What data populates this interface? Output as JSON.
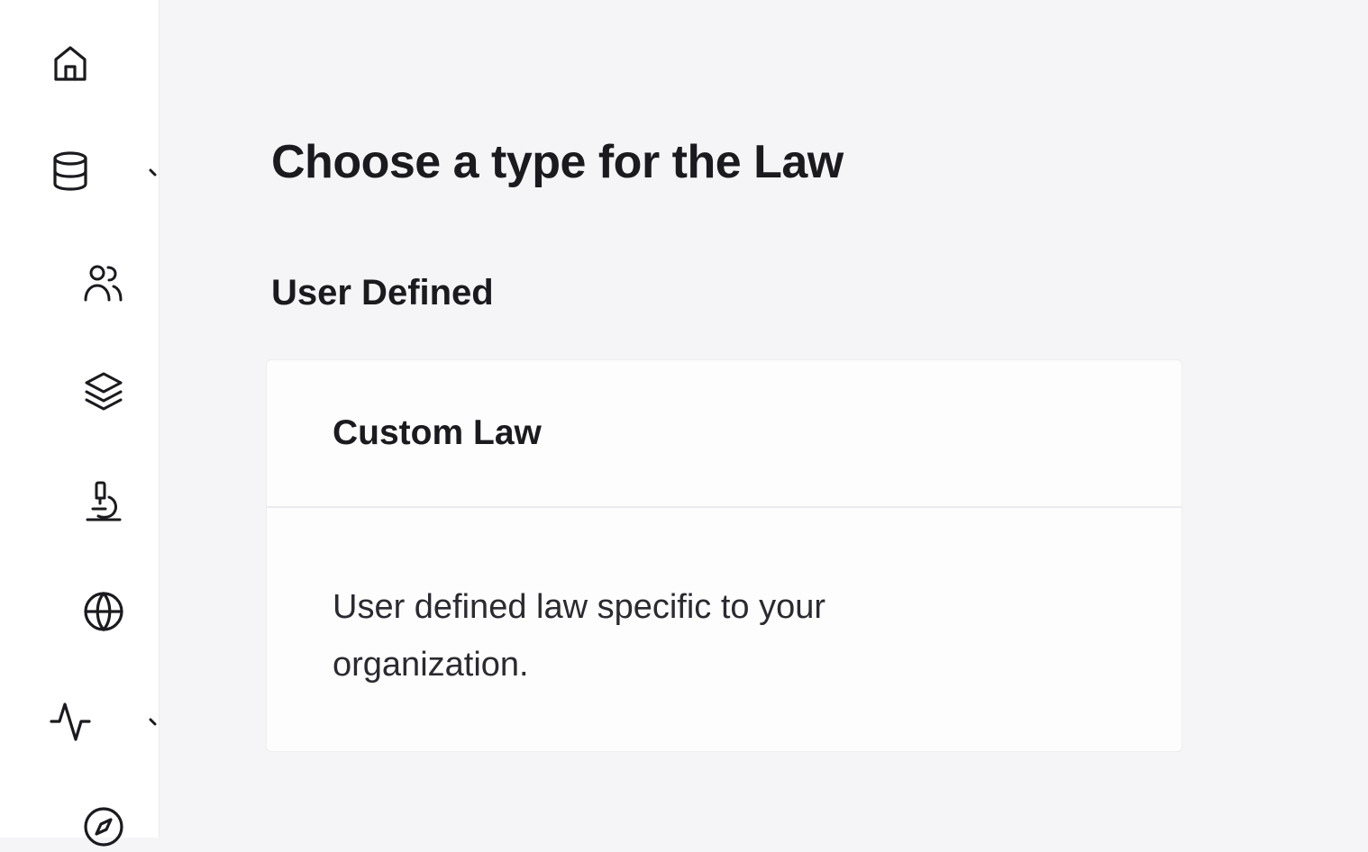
{
  "sidebar": {
    "items": [
      {
        "icon": "home-icon"
      },
      {
        "icon": "database-icon"
      },
      {
        "icon": "users-icon"
      },
      {
        "icon": "layers-icon"
      },
      {
        "icon": "microscope-icon"
      },
      {
        "icon": "globe-icon"
      },
      {
        "icon": "activity-icon"
      },
      {
        "icon": "compass-icon"
      }
    ]
  },
  "main": {
    "title": "Choose a type for the Law",
    "section_title": "User Defined",
    "card": {
      "title": "Custom Law",
      "description": "User defined law specific to your organization."
    }
  },
  "colors": {
    "background": "#f5f4f7",
    "sidebar": "#ffffff",
    "card": "#fdfdfe",
    "text": "#1b1b1f"
  }
}
